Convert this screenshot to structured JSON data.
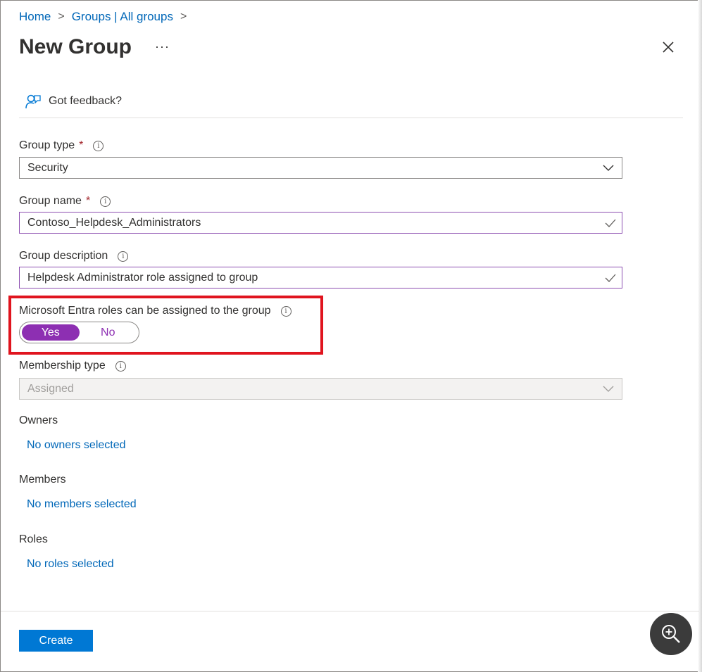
{
  "breadcrumb": {
    "home": "Home",
    "groups": "Groups | All groups",
    "separator": ">"
  },
  "header": {
    "title": "New Group",
    "more": "···"
  },
  "feedback": {
    "label": "Got feedback?"
  },
  "group_type": {
    "label": "Group type",
    "required": "*",
    "value": "Security"
  },
  "group_name": {
    "label": "Group name",
    "required": "*",
    "value": "Contoso_Helpdesk_Administrators"
  },
  "group_description": {
    "label": "Group description",
    "value": "Helpdesk Administrator role assigned to group"
  },
  "entra_roles": {
    "label": "Microsoft Entra roles can be assigned to the group",
    "yes": "Yes",
    "no": "No",
    "selected": "Yes"
  },
  "membership_type": {
    "label": "Membership type",
    "value": "Assigned"
  },
  "owners": {
    "label": "Owners",
    "link": "No owners selected"
  },
  "members": {
    "label": "Members",
    "link": "No members selected"
  },
  "roles": {
    "label": "Roles",
    "link": "No roles selected"
  },
  "footer": {
    "create_label": "Create"
  },
  "colors": {
    "accent": "#0078d4",
    "toggle": "#8d2fb2",
    "highlight": "#e0141e",
    "link": "#0067b8"
  }
}
